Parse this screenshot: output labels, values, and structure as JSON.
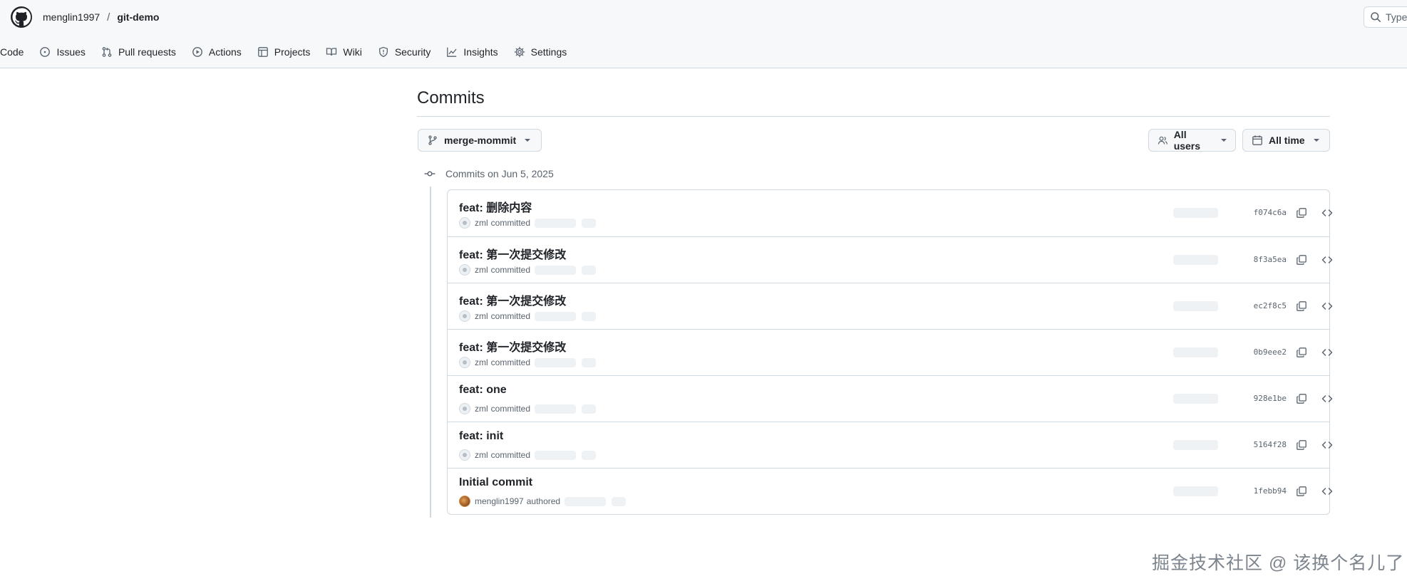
{
  "header": {
    "owner": "menglin1997",
    "separator": "/",
    "repo": "git-demo",
    "search_placeholder": "Type"
  },
  "nav": {
    "tabs": [
      {
        "label": "Code",
        "icon": "code-icon"
      },
      {
        "label": "Issues",
        "icon": "issue-icon"
      },
      {
        "label": "Pull requests",
        "icon": "pull-request-icon"
      },
      {
        "label": "Actions",
        "icon": "play-icon"
      },
      {
        "label": "Projects",
        "icon": "table-icon"
      },
      {
        "label": "Wiki",
        "icon": "book-icon"
      },
      {
        "label": "Security",
        "icon": "shield-icon"
      },
      {
        "label": "Insights",
        "icon": "graph-icon"
      },
      {
        "label": "Settings",
        "icon": "gear-icon"
      }
    ]
  },
  "main": {
    "title": "Commits",
    "branch": "merge-mommit",
    "users_filter": "All users",
    "time_filter": "All time",
    "date_heading": "Commits on Jun 5, 2025"
  },
  "commits": [
    {
      "message": "feat: 删除内容",
      "author": "zml",
      "verb": "committed",
      "sha": "f074c6a",
      "avatar": "default"
    },
    {
      "message": "feat: 第一次提交修改",
      "author": "zml",
      "verb": "committed",
      "sha": "8f3a5ea",
      "avatar": "default"
    },
    {
      "message": "feat: 第一次提交修改",
      "author": "zml",
      "verb": "committed",
      "sha": "ec2f8c5",
      "avatar": "default"
    },
    {
      "message": "feat: 第一次提交修改",
      "author": "zml",
      "verb": "committed",
      "sha": "0b9eee2",
      "avatar": "default"
    },
    {
      "message": "feat: one",
      "author": "zml",
      "verb": "committed",
      "sha": "928e1be",
      "avatar": "default"
    },
    {
      "message": "feat: init",
      "author": "zml",
      "verb": "committed",
      "sha": "5164f28",
      "avatar": "default"
    },
    {
      "message": "Initial commit",
      "author": "menglin1997",
      "verb": "authored",
      "sha": "1febb94",
      "avatar": "photo"
    }
  ],
  "watermark": "掘金技术社区 @ 该换个名儿了",
  "colors": {
    "header_bg": "#f6f8fa",
    "border": "#d1d9e0",
    "text": "#1f2328",
    "muted": "#59636e",
    "skeleton": "#eff2f5"
  }
}
